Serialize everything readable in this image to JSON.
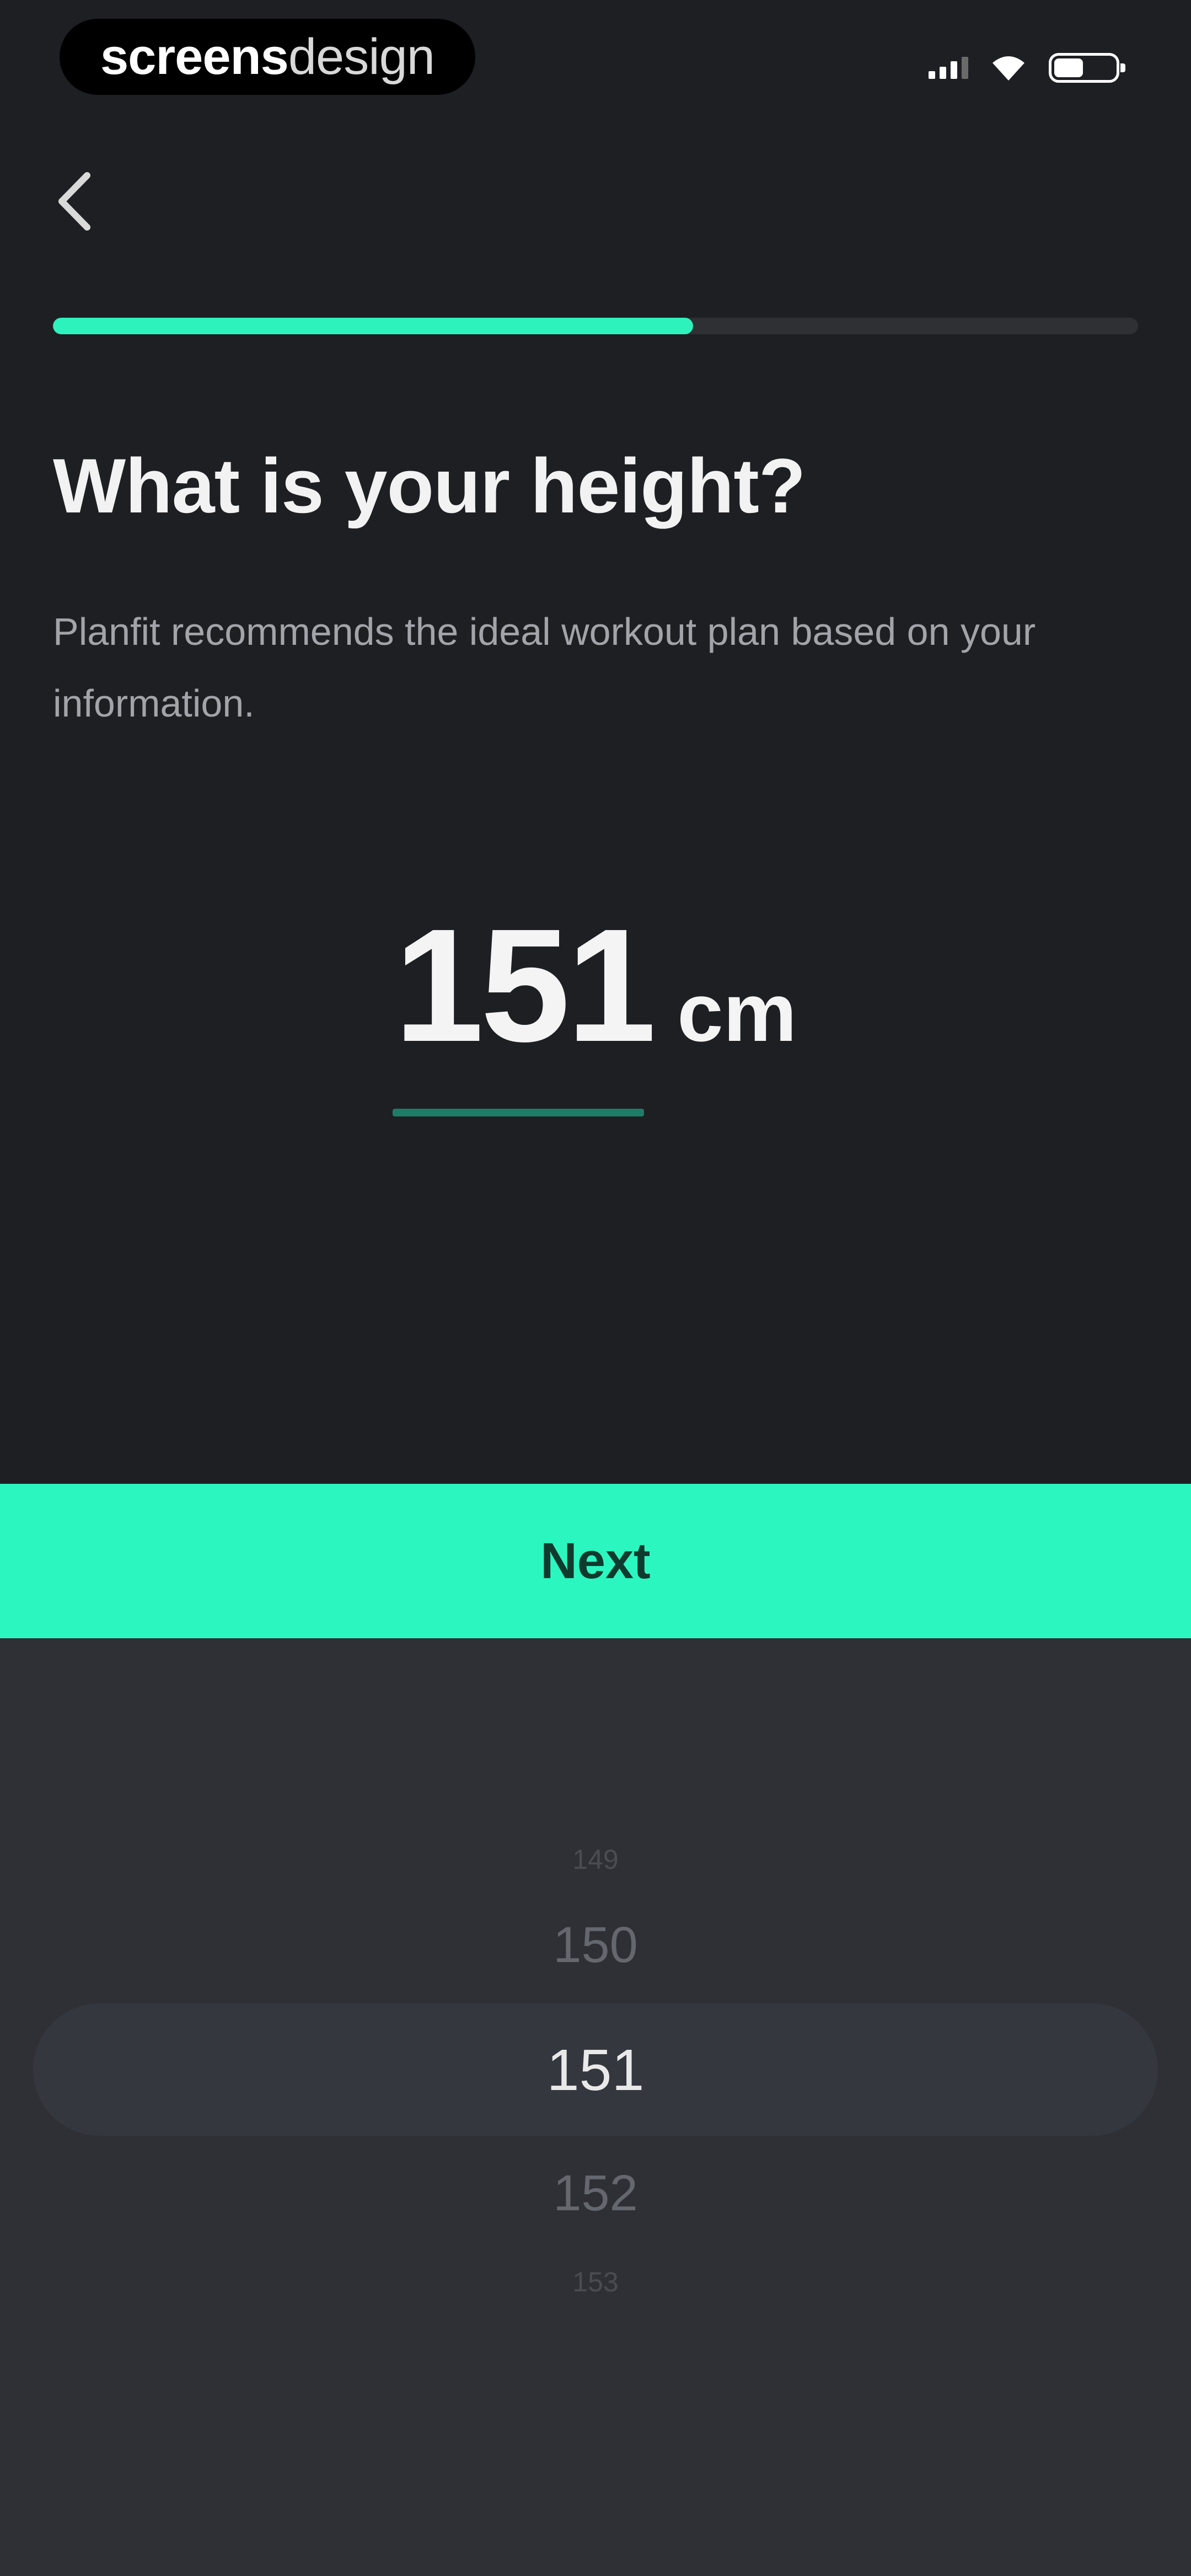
{
  "status_bar": {
    "brand_bold": "screens",
    "brand_light": "design"
  },
  "progress": {
    "value": 0.59,
    "color": "#2ef2bb"
  },
  "header": {
    "title": "What is your height?",
    "subtitle": "Planfit recommends the ideal workout plan based on your information."
  },
  "height": {
    "value": "151",
    "unit": "cm"
  },
  "next_button": {
    "label": "Next",
    "color": "#2cf6c0"
  },
  "picker": {
    "far_above": "149",
    "above": "150",
    "selected": "151",
    "below": "152",
    "far_below": "153"
  },
  "icons": {
    "back": "chevron-left-icon",
    "signal": "cellular-signal-icon",
    "wifi": "wifi-icon",
    "battery": "battery-icon"
  }
}
